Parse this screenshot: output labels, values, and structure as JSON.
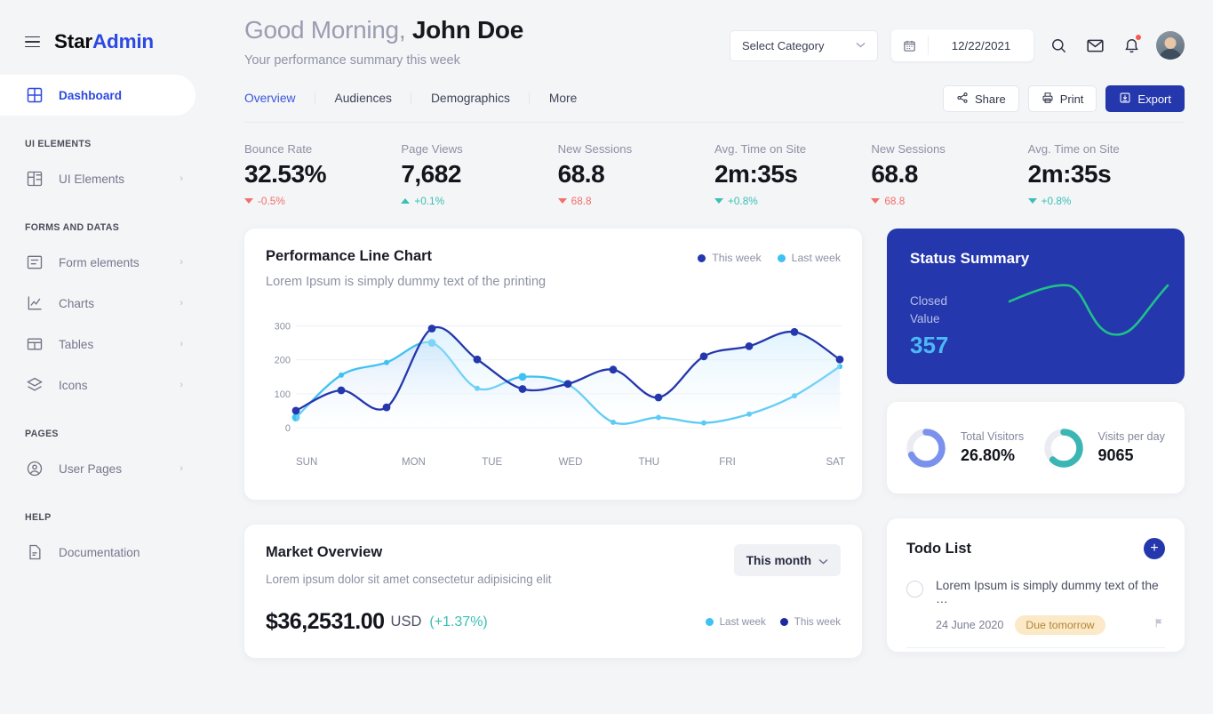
{
  "brand": {
    "name_first": "Star",
    "name_second": "Admin"
  },
  "sidebar": {
    "groups": [
      {
        "title": "",
        "items": [
          {
            "label": "Dashboard",
            "icon": "grid-icon",
            "active": true,
            "chevron": ""
          }
        ]
      },
      {
        "title": "UI ELEMENTS",
        "items": [
          {
            "label": "UI Elements",
            "icon": "layout-icon",
            "chevron": "›"
          }
        ]
      },
      {
        "title": "FORMS AND DATAS",
        "items": [
          {
            "label": "Form elements",
            "icon": "form-icon",
            "chevron": "›"
          },
          {
            "label": "Charts",
            "icon": "chart-icon",
            "chevron": "›"
          },
          {
            "label": "Tables",
            "icon": "table-icon",
            "chevron": "›"
          },
          {
            "label": "Icons",
            "icon": "layers-icon",
            "chevron": "›"
          }
        ]
      },
      {
        "title": "PAGES",
        "items": [
          {
            "label": "User Pages",
            "icon": "user-circle-icon",
            "chevron": "›"
          }
        ]
      },
      {
        "title": "HELP",
        "items": [
          {
            "label": "Documentation",
            "icon": "document-icon",
            "chevron": ""
          }
        ]
      }
    ]
  },
  "header": {
    "greeting_prefix": "Good Morning,",
    "user_name": "John Doe",
    "subtitle": "Your performance summary this week",
    "category_select": {
      "value": "Select Category",
      "caret": "⌄"
    },
    "date_value": "12/22/2021",
    "icons": {
      "search": "search-icon",
      "mail": "mail-icon",
      "bell": "bell-icon",
      "avatar": "avatar"
    }
  },
  "tabs": [
    {
      "label": "Overview",
      "active": true
    },
    {
      "label": "Audiences",
      "active": false
    },
    {
      "label": "Demographics",
      "active": false
    },
    {
      "label": "More",
      "active": false
    }
  ],
  "actions": [
    {
      "label": "Share",
      "icon": "share-icon",
      "style": "outline"
    },
    {
      "label": "Print",
      "icon": "print-icon",
      "style": "outline"
    },
    {
      "label": "Export",
      "icon": "export-icon",
      "style": "primary"
    }
  ],
  "kpis": [
    {
      "label": "Bounce Rate",
      "value": "32.53%",
      "delta": "-0.5%",
      "dir": "down"
    },
    {
      "label": "Page Views",
      "value": "7,682",
      "delta": "+0.1%",
      "dir": "up"
    },
    {
      "label": "New Sessions",
      "value": "68.8",
      "delta": "68.8",
      "dir": "down"
    },
    {
      "label": "Avg. Time on Site",
      "value": "2m:35s",
      "delta": "+0.8%",
      "dir": "up"
    },
    {
      "label": "New Sessions",
      "value": "68.8",
      "delta": "68.8",
      "dir": "down"
    },
    {
      "label": "Avg. Time on Site",
      "value": "2m:35s",
      "delta": "+0.8%",
      "dir": "up"
    }
  ],
  "performance_card": {
    "title": "Performance Line Chart",
    "subtitle": "Lorem Ipsum is simply dummy text of the printing",
    "legend": [
      {
        "label": "This week",
        "color": "#2437ac"
      },
      {
        "label": "Last week",
        "color": "#3ec1f3"
      }
    ]
  },
  "status_summary": {
    "title": "Status Summary",
    "label_line1": "Closed",
    "label_line2": "Value",
    "value": "357",
    "spark_color": "#1fc08a"
  },
  "visitors": [
    {
      "label": "Total Visitors",
      "value": "26.80%",
      "percent": 68,
      "color": "#7b92ed"
    },
    {
      "label": "Visits per day",
      "value": "9065",
      "percent": 62,
      "color": "#3cb6b4"
    }
  ],
  "market": {
    "title": "Market Overview",
    "subtitle": "Lorem ipsum dolor sit amet consectetur adipisicing elit",
    "period": "This month",
    "period_caret": "⌄",
    "amount": "$36,2531.00",
    "currency": "USD",
    "change": "(+1.37%)",
    "legend": [
      {
        "label": "Last week",
        "color": "#3ec1f3"
      },
      {
        "label": "This week",
        "color": "#1b2a9e"
      }
    ]
  },
  "todo": {
    "title": "Todo List",
    "add_label": "+",
    "items": [
      {
        "text": "Lorem Ipsum is simply dummy text of the …",
        "date": "24 June 2020",
        "badge": "Due tomorrow"
      }
    ]
  },
  "chart_data": {
    "type": "line",
    "title": "Performance Line Chart",
    "xlabel": "",
    "ylabel": "",
    "ylim": [
      0,
      330
    ],
    "yticks": [
      0,
      100,
      200,
      300
    ],
    "grid": true,
    "legend_position": "top-right",
    "categories": [
      "SUN",
      "MON",
      "TUE",
      "WED",
      "THU",
      "FRI",
      "SAT"
    ],
    "x": [
      0,
      0.5,
      1,
      1.5,
      2,
      2.5,
      3,
      3.5,
      4,
      4.5,
      5,
      5.5,
      6
    ],
    "series": [
      {
        "name": "This week",
        "color": "#2437ac",
        "values": [
          50,
          110,
          60,
          292,
          201,
          114,
          129,
          171,
          89,
          210,
          240,
          282,
          201
        ]
      },
      {
        "name": "Last week",
        "color": "#3ec1f3",
        "values": [
          30,
          155,
          192,
          250,
          116,
          150,
          128,
          16,
          30,
          14,
          40,
          94,
          180
        ]
      }
    ]
  }
}
